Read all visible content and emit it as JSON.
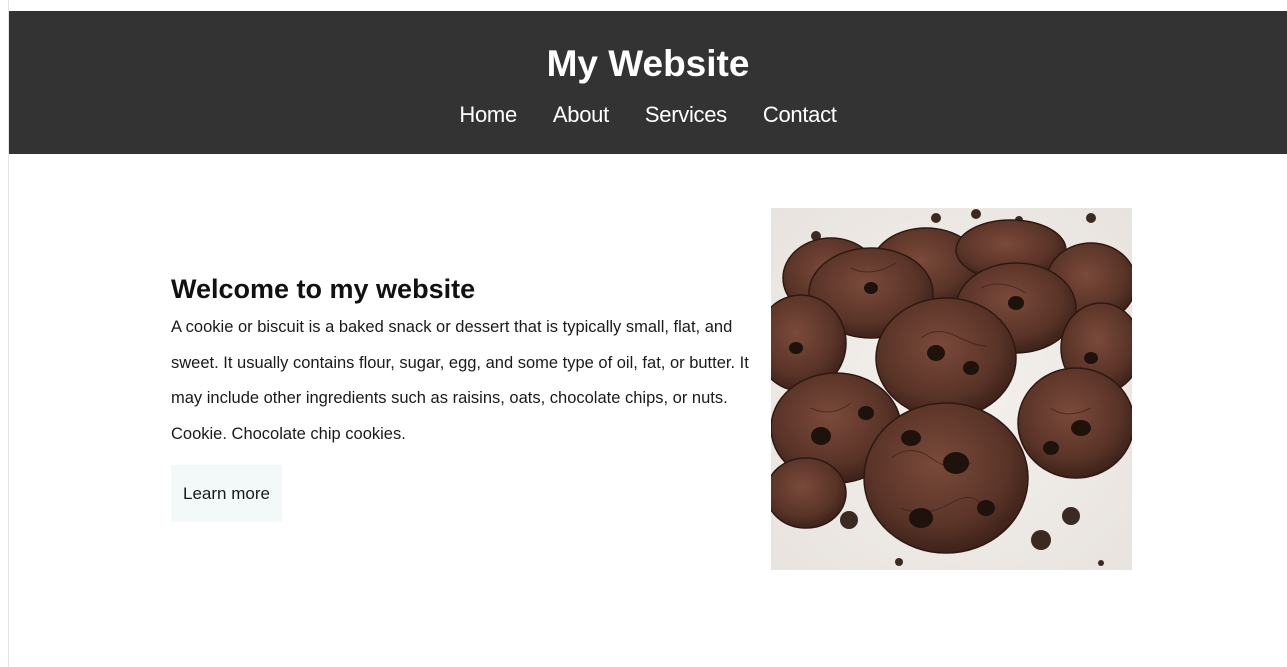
{
  "header": {
    "title": "My Website",
    "nav": [
      {
        "label": "Home"
      },
      {
        "label": "About"
      },
      {
        "label": "Services"
      },
      {
        "label": "Contact"
      }
    ]
  },
  "hero": {
    "heading": "Welcome to my website",
    "body": "A cookie or biscuit is a baked snack or dessert that is typically small, flat, and sweet. It usually contains flour, sugar, egg, and some type of oil, fat, or butter. It may include other ingredients such as raisins, oats, chocolate chips, or nuts. Cookie. Chocolate chip cookies.",
    "button_label": "Learn more",
    "image_icon": "cookies-photo"
  },
  "colors": {
    "header_bg": "#333333",
    "header_text": "#ffffff",
    "button_bg": "#f3f9f8",
    "cookie_brown": "#5a3428"
  }
}
